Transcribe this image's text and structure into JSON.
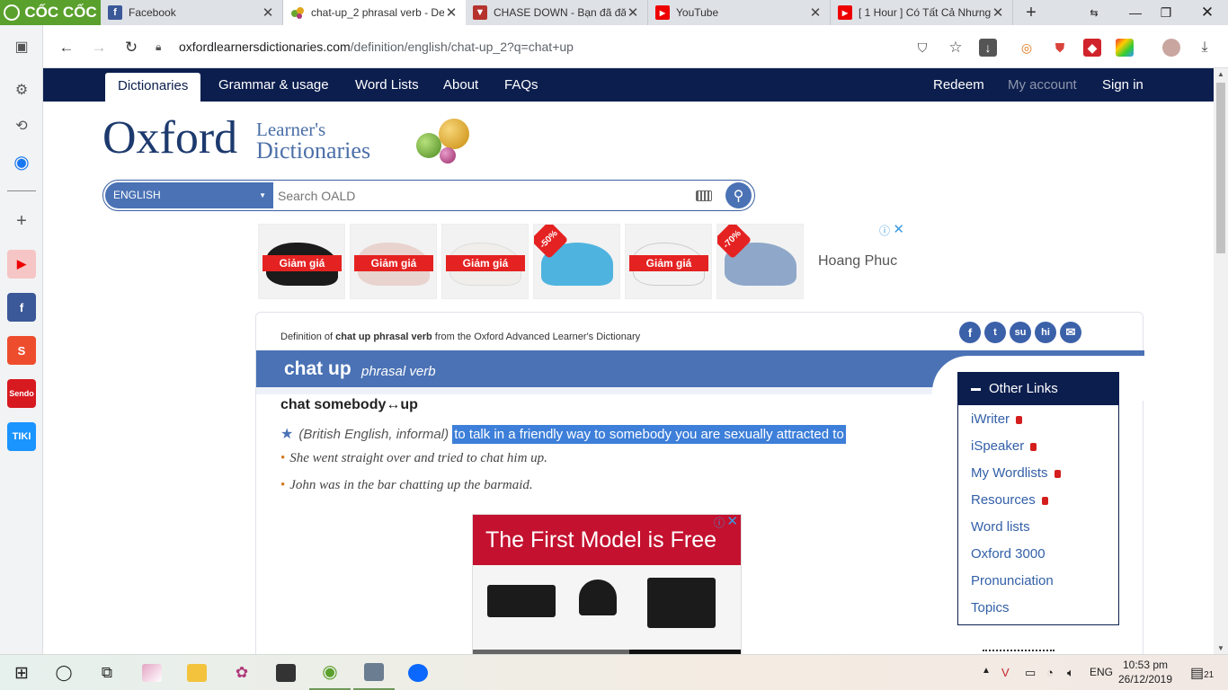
{
  "browser": {
    "brand": "CỐC CỐC",
    "tabs": [
      {
        "title": "Facebook",
        "icon": "facebook-icon"
      },
      {
        "title": "chat-up_2 phrasal verb - De",
        "icon": "oxford-balls-icon"
      },
      {
        "title": "CHASE DOWN - Bạn đã đăn",
        "icon": "shield-crest-icon"
      },
      {
        "title": "YouTube",
        "icon": "youtube-icon"
      },
      {
        "title": "[ 1 Hour ] Có Tất Cả Nhưng",
        "icon": "youtube-icon"
      }
    ],
    "url_domain": "oxfordlearnersdictionaries.com",
    "url_path": "/definition/english/chat-up_2?q=chat+up"
  },
  "site": {
    "nav": [
      "Dictionaries",
      "Grammar & usage",
      "Word Lists",
      "About",
      "FAQs"
    ],
    "nav_right": [
      "Redeem",
      "My account",
      "Sign in"
    ],
    "logo_main": "Oxford",
    "logo_line1": "Learner's",
    "logo_line2": "Dictionaries",
    "search_lang": "ENGLISH",
    "search_placeholder": "Search OALD"
  },
  "ad1": {
    "sale_label": "Giảm giá",
    "badges": [
      "-50%",
      "-70%"
    ],
    "brand": "Hoang Phuc"
  },
  "entry": {
    "def_prefix": "Definition of ",
    "def_bold": "chat up phrasal verb",
    "def_suffix": " from the Oxford Advanced Learner's Dictionary",
    "headword": "chat up",
    "pos": "phrasal verb",
    "phrase": "chat somebody↔up",
    "label": "(British English, informal)",
    "definition": "to talk in a friendly way to somebody you are sexually attracted to",
    "examples": [
      "She went straight over and tried to chat him up.",
      "John was in the bar chatting up the barmaid."
    ]
  },
  "ad2": {
    "headline": "The First Model is Free"
  },
  "other_links": {
    "title": "Other Links",
    "items": [
      {
        "label": "iWriter",
        "locked": true
      },
      {
        "label": "iSpeaker",
        "locked": true
      },
      {
        "label": "My Wordlists",
        "locked": true
      },
      {
        "label": "Resources",
        "locked": true
      },
      {
        "label": "Word lists",
        "locked": false
      },
      {
        "label": "Oxford 3000",
        "locked": false
      },
      {
        "label": "Pronunciation",
        "locked": false
      },
      {
        "label": "Topics",
        "locked": false
      }
    ]
  },
  "taskbar": {
    "lang": "ENG",
    "time": "10:53 pm",
    "date": "26/12/2019",
    "notifications": "21"
  },
  "colors": {
    "navy": "#0c1e4e",
    "oxford_blue": "#4a72b5",
    "selection": "#3d7fd9",
    "accent_red": "#c4112f",
    "coccoc_green": "#5aa02c"
  }
}
